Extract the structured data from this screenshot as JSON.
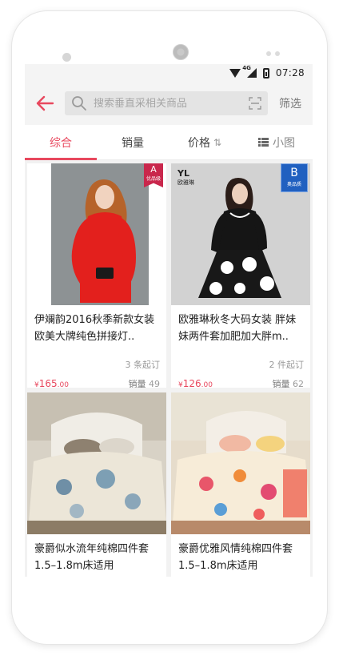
{
  "status_bar": {
    "network": "4G",
    "time": "07:28"
  },
  "search": {
    "placeholder": "搜索垂直采相关商品",
    "filter_label": "筛选"
  },
  "tabs": [
    {
      "label": "综合",
      "active": true
    },
    {
      "label": "销量",
      "active": false
    },
    {
      "label": "价格",
      "active": false
    },
    {
      "label": "小图",
      "active": false
    }
  ],
  "products": [
    {
      "title": "伊斓韵2016秋季新款女装欧美大牌纯色拼接灯..",
      "moq": "3 条起订",
      "price_symbol": "¥",
      "price_int": "165",
      "price_dec": ".00",
      "sales_label": "销量",
      "sales": "49",
      "badge": "A",
      "badge_sub": "优品级"
    },
    {
      "title": "欧雅琳秋冬大码女装 胖妹妹两件套加肥加大胖m..",
      "moq": "2 件起订",
      "price_symbol": "¥",
      "price_int": "126",
      "price_dec": ".00",
      "sales_label": "销量",
      "sales": "62",
      "badge": "B",
      "badge_sub": "奥品质",
      "brand": "YL",
      "brand_sub": "欧雅琳"
    },
    {
      "title": "豪爵似水流年纯棉四件套1.5–1.8m床适用"
    },
    {
      "title": "豪爵优雅风情纯棉四件套1.5–1.8m床适用"
    }
  ],
  "colors": {
    "accent": "#e8485e",
    "badge_a": "#c9274c",
    "badge_b": "#2060c0"
  }
}
